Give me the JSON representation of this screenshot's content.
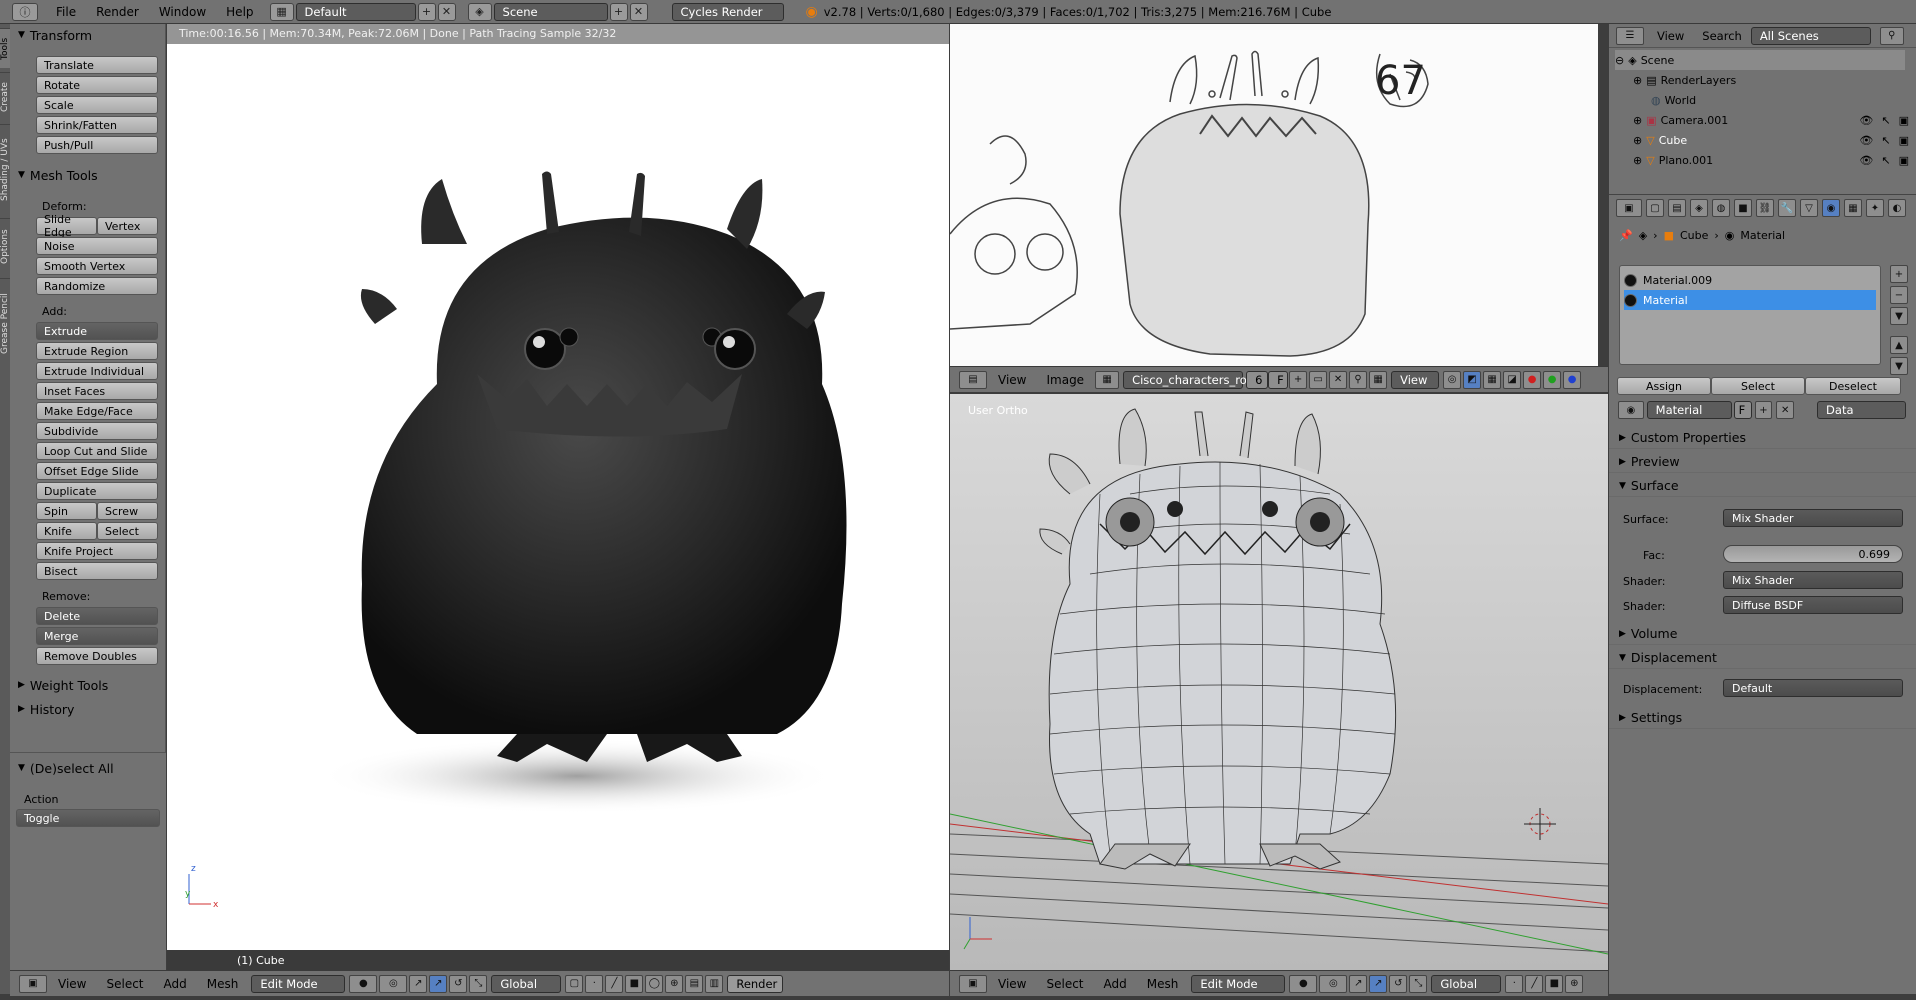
{
  "topbar": {
    "menus": [
      "File",
      "Render",
      "Window",
      "Help"
    ],
    "layout": "Default",
    "scene": "Scene",
    "engine": "Cycles Render",
    "status": "v2.78 | Verts:0/1,680 | Edges:0/3,379 | Faces:0/1,702 | Tris:3,275 | Mem:216.76M | Cube"
  },
  "vtabs": [
    "Tools",
    "Create",
    "Shading / UVs",
    "Options",
    "Grease Pencil"
  ],
  "tools": {
    "transform_title": "Transform",
    "transform": [
      "Translate",
      "Rotate",
      "Scale",
      "Shrink/Fatten",
      "Push/Pull"
    ],
    "mesh_title": "Mesh Tools",
    "deform_label": "Deform:",
    "slide_edge": "Slide Edge",
    "vertex": "Vertex",
    "deform": [
      "Noise",
      "Smooth Vertex",
      "Randomize"
    ],
    "add_label": "Add:",
    "extrude": "Extrude",
    "add": [
      "Extrude Region",
      "Extrude Individual",
      "Inset Faces",
      "Make Edge/Face",
      "Subdivide",
      "Loop Cut and Slide",
      "Offset Edge Slide",
      "Duplicate"
    ],
    "spin": "Spin",
    "screw": "Screw",
    "knife": "Knife",
    "select": "Select",
    "knife_project": "Knife Project",
    "bisect": "Bisect",
    "remove_label": "Remove:",
    "delete": "Delete",
    "merge": "Merge",
    "remove_doubles": "Remove Doubles",
    "weight_tools": "Weight Tools",
    "history": "History",
    "deselect_title": "(De)select All",
    "action_label": "Action",
    "action_value": "Toggle"
  },
  "render_view": {
    "status": "Time:00:16.56 | Mem:70.34M, Peak:72.06M | Done | Path Tracing Sample 32/32",
    "object_label": "(1) Cube",
    "header": {
      "menus": [
        "View",
        "Select",
        "Add",
        "Mesh"
      ],
      "mode": "Edit Mode",
      "orientation": "Global",
      "render_label": "Render"
    }
  },
  "image_view": {
    "sketch_number": "67",
    "header": {
      "menus": [
        "View",
        "Image"
      ],
      "image_name": "Cisco_characters_ro...",
      "users": "6",
      "fake": "F",
      "view": "View"
    }
  },
  "ortho_view": {
    "label": "User Ortho",
    "header": {
      "menus": [
        "View",
        "Select",
        "Add",
        "Mesh"
      ],
      "mode": "Edit Mode",
      "orientation": "Global"
    }
  },
  "outliner": {
    "menus": [
      "View",
      "Search"
    ],
    "filter": "All Scenes",
    "rows": [
      "Scene",
      "RenderLayers",
      "World",
      "Camera.001",
      "Cube",
      "Plano.001"
    ]
  },
  "properties": {
    "breadcrumb_object": "Cube",
    "breadcrumb_material": "Material",
    "materials": [
      "Material.009",
      "Material"
    ],
    "assign": "Assign",
    "select": "Select",
    "deselect": "Deselect",
    "material_name": "Material",
    "fake_user": "F",
    "link": "Data",
    "custom_properties": "Custom Properties",
    "preview": "Preview",
    "surface_title": "Surface",
    "surface_label": "Surface:",
    "surface_value": "Mix Shader",
    "fac_label": "Fac:",
    "fac_value": "0.699",
    "shader_label": "Shader:",
    "shader1": "Mix Shader",
    "shader2": "Diffuse BSDF",
    "volume": "Volume",
    "displacement_title": "Displacement",
    "displacement_label": "Displacement:",
    "displacement_value": "Default",
    "settings": "Settings"
  },
  "colors": {
    "accent": "#5680c2",
    "selection": "#3d8fe6",
    "background": "#727272"
  }
}
